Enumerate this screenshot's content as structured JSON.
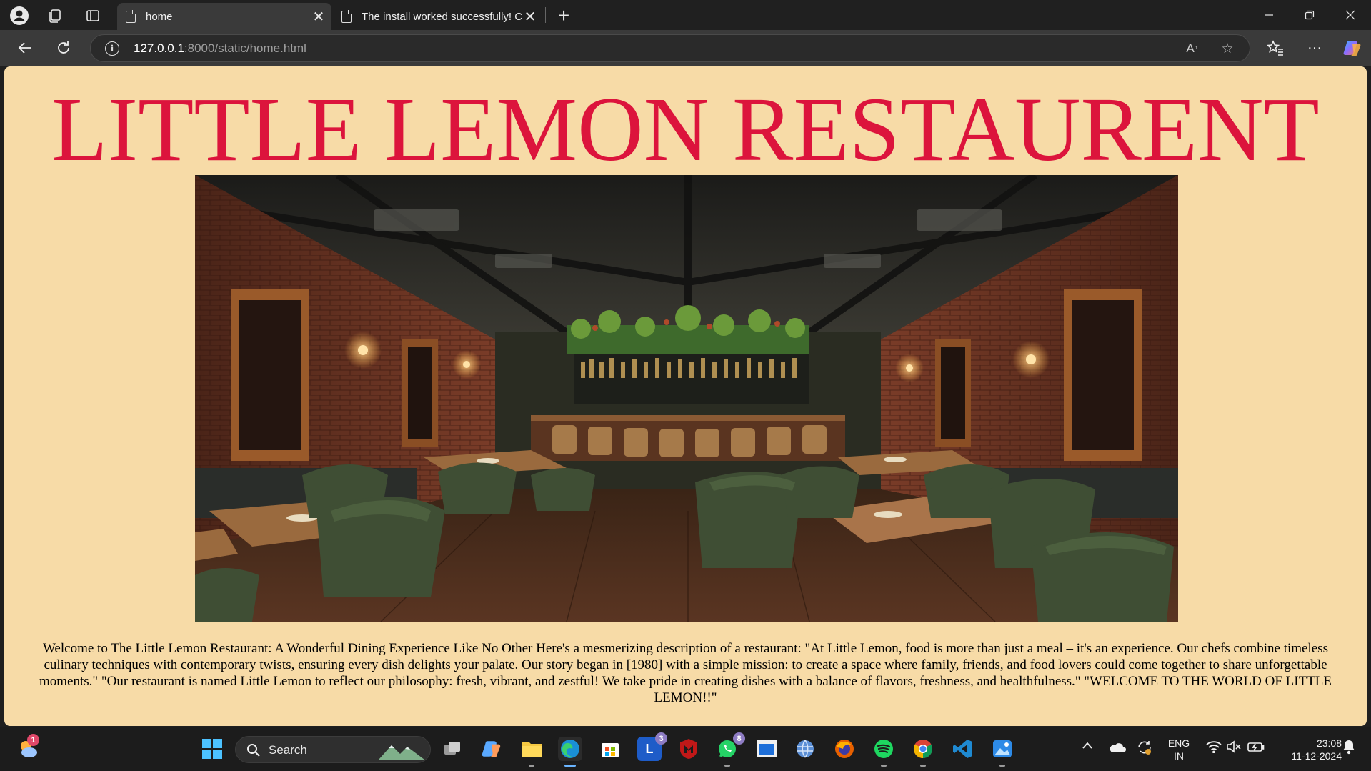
{
  "browser": {
    "tabs": [
      {
        "title": "home",
        "active": true
      },
      {
        "title": "The install worked successfully! Co",
        "active": false
      }
    ],
    "new_tab_label": "+",
    "url_host": "127.0.0.1",
    "url_rest": ":8000/static/home.html",
    "window_controls": {
      "minimize": "—",
      "restore": "❐",
      "close": "✕"
    },
    "icons": [
      "profile-icon",
      "collections-icon",
      "tab-actions-icon",
      "back-icon",
      "refresh-icon",
      "site-info-icon",
      "read-aloud-icon",
      "favorite-icon",
      "favorites-bar-icon",
      "more-icon",
      "copilot-icon"
    ]
  },
  "page": {
    "heading": "LITTLE LEMON RESTAURENT",
    "heading_color": "#dc143c",
    "background_color": "#f7dba7",
    "image_alt": "Restaurant interior with green chairs and wooden tables",
    "paragraph": "Welcome to The Little Lemon Restaurant: A Wonderful Dining Experience Like No Other Here's a mesmerizing description of a restaurant: \"At Little Lemon, food is more than just a meal – it's an experience. Our chefs combine timeless culinary techniques with contemporary twists, ensuring every dish delights your palate. Our story began in [1980] with a simple mission: to create a space where family, friends, and food lovers could come together to share unforgettable moments.\" \"Our restaurant is named Little Lemon to reflect our philosophy: fresh, vibrant, and zestful! We take pride in creating dishes with a balance of flavors, freshness, and healthfulness.\" \"WELCOME TO THE WORLD OF LITTLE LEMON!!\""
  },
  "taskbar": {
    "weather_badge": "1",
    "search_label": "Search",
    "apps": [
      {
        "name": "copilot",
        "badge": ""
      },
      {
        "name": "file-explorer",
        "badge": ""
      },
      {
        "name": "edge",
        "badge": ""
      },
      {
        "name": "store",
        "badge": ""
      },
      {
        "name": "l-app",
        "badge": "3"
      },
      {
        "name": "mcafee",
        "badge": ""
      },
      {
        "name": "whatsapp",
        "badge": "8"
      },
      {
        "name": "window-app",
        "badge": ""
      },
      {
        "name": "globe-app",
        "badge": ""
      },
      {
        "name": "firefox",
        "badge": ""
      },
      {
        "name": "spotify",
        "badge": ""
      },
      {
        "name": "chrome",
        "badge": ""
      },
      {
        "name": "vscode",
        "badge": ""
      },
      {
        "name": "photos",
        "badge": ""
      }
    ],
    "tray": {
      "language_top": "ENG",
      "language_bottom": "IN",
      "time": "23:08",
      "date": "11-12-2024"
    }
  }
}
